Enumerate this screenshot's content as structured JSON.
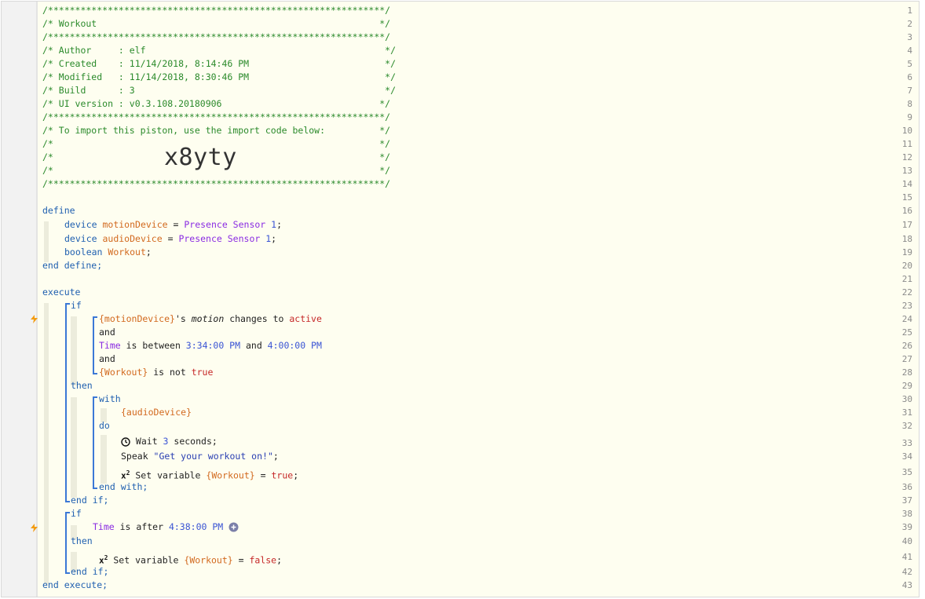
{
  "header": {
    "border": "/**************************************************************/",
    "title": "/* Workout                                                    */",
    "blank_border": "/**************************************************************/",
    "author": "/* Author     : elf                                            */",
    "created": "/* Created    : 11/14/2018, 8:14:46 PM                         */",
    "modified": "/* Modified   : 11/14/2018, 8:30:46 PM                         */",
    "build": "/* Build      : 3                                              */",
    "ui_version": "/* UI version : v0.3.108.20180906                             */",
    "import_note": "/* To import this piston, use the import code below:          */",
    "empty_comment": "/*                                                            */",
    "empty_comment_code": "/*",
    "empty_comment_end": "*/",
    "import_code": "x8yty"
  },
  "line_numbers": [
    "1",
    "2",
    "3",
    "4",
    "5",
    "6",
    "7",
    "8",
    "9",
    "10",
    "11",
    "12",
    "13",
    "14",
    "15",
    "16",
    "17",
    "18",
    "19",
    "20",
    "21",
    "22",
    "23",
    "24",
    "25",
    "26",
    "27",
    "28",
    "29",
    "30",
    "31",
    "32",
    "33",
    "34",
    "35",
    "36",
    "37",
    "38",
    "39",
    "40",
    "41",
    "42",
    "43"
  ],
  "code": {
    "define": "define",
    "device_kw": "device",
    "motion_var": "motionDevice",
    "audio_var": "audioDevice",
    "eq": " = ",
    "presence": "Presence Sensor",
    "one": "1",
    "semi": ";",
    "boolean_kw": "boolean",
    "workout_var": "Workout",
    "end_define": "end define;",
    "execute": "execute",
    "if": "if",
    "motion_ref": "{motionDevice}",
    "s_motion_prefix": "'s ",
    "motion_attr": "motion",
    "changes_to": " changes to ",
    "active": "active",
    "and": "and",
    "time": "Time",
    "is_between": " is between ",
    "t1": "3:34:00 PM",
    "and_mid": " and ",
    "t2": "4:00:00 PM",
    "workout_ref": "{Workout}",
    "is_not": " is not ",
    "true": "true",
    "then": "then",
    "with": "with",
    "audio_ref": "{audioDevice}",
    "do": "do",
    "wait": " Wait ",
    "three": "3",
    "seconds": " seconds;",
    "speak": "Speak ",
    "speak_str": "\"Get your workout on!\"",
    "set_variable": " Set variable ",
    "assign": " = ",
    "end_with": "end with;",
    "end_if": "end if;",
    "is_after": " is after ",
    "t3": "4:38:00 PM",
    "false": "false",
    "end_execute": "end execute;"
  },
  "colors": {
    "comment": "#2b8a2b",
    "keyword": "#2060b0",
    "variable": "#d2691e",
    "device": "#8a2be2",
    "number": "#3a54d4",
    "bracket": "#3b78d6",
    "bolt": "#f39c12"
  }
}
